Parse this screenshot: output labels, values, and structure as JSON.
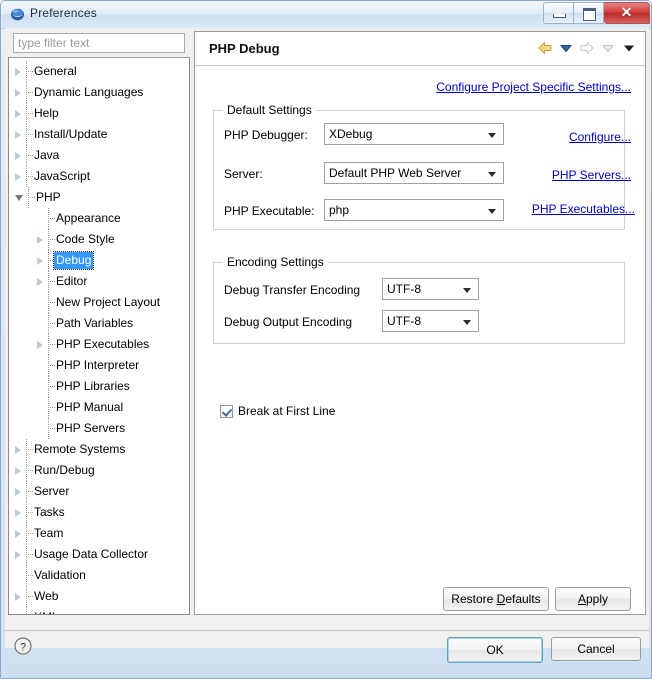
{
  "window": {
    "title": "Preferences",
    "icon": "eclipse-sphere-icon",
    "minimize_label": "",
    "maximize_label": "",
    "close_label": "✕"
  },
  "sidebar": {
    "filter": {
      "placeholder": "type filter text",
      "value": ""
    },
    "items": [
      {
        "label": "General",
        "depth": 0,
        "arrow": "collapsed"
      },
      {
        "label": "Dynamic Languages",
        "depth": 0,
        "arrow": "collapsed"
      },
      {
        "label": "Help",
        "depth": 0,
        "arrow": "collapsed"
      },
      {
        "label": "Install/Update",
        "depth": 0,
        "arrow": "collapsed"
      },
      {
        "label": "Java",
        "depth": 0,
        "arrow": "collapsed"
      },
      {
        "label": "JavaScript",
        "depth": 0,
        "arrow": "collapsed"
      },
      {
        "label": "PHP",
        "depth": 0,
        "arrow": "expanded"
      },
      {
        "label": "Appearance",
        "depth": 1,
        "arrow": "none"
      },
      {
        "label": "Code Style",
        "depth": 1,
        "arrow": "collapsed"
      },
      {
        "label": "Debug",
        "depth": 1,
        "arrow": "collapsed",
        "selected": true
      },
      {
        "label": "Editor",
        "depth": 1,
        "arrow": "collapsed"
      },
      {
        "label": "New Project Layout",
        "depth": 1,
        "arrow": "none"
      },
      {
        "label": "Path Variables",
        "depth": 1,
        "arrow": "none"
      },
      {
        "label": "PHP Executables",
        "depth": 1,
        "arrow": "collapsed"
      },
      {
        "label": "PHP Interpreter",
        "depth": 1,
        "arrow": "none"
      },
      {
        "label": "PHP Libraries",
        "depth": 1,
        "arrow": "none"
      },
      {
        "label": "PHP Manual",
        "depth": 1,
        "arrow": "none"
      },
      {
        "label": "PHP Servers",
        "depth": 1,
        "arrow": "none"
      },
      {
        "label": "Remote Systems",
        "depth": 0,
        "arrow": "collapsed"
      },
      {
        "label": "Run/Debug",
        "depth": 0,
        "arrow": "collapsed"
      },
      {
        "label": "Server",
        "depth": 0,
        "arrow": "collapsed"
      },
      {
        "label": "Tasks",
        "depth": 0,
        "arrow": "collapsed"
      },
      {
        "label": "Team",
        "depth": 0,
        "arrow": "collapsed"
      },
      {
        "label": "Usage Data Collector",
        "depth": 0,
        "arrow": "collapsed"
      },
      {
        "label": "Validation",
        "depth": 0,
        "arrow": "none"
      },
      {
        "label": "Web",
        "depth": 0,
        "arrow": "collapsed"
      },
      {
        "label": "XML",
        "depth": 0,
        "arrow": "collapsed"
      }
    ]
  },
  "page": {
    "title": "PHP Debug",
    "nav_icons": [
      {
        "name": "back-arrow-icon",
        "state": "enabled"
      },
      {
        "name": "back-history-dropdown-icon",
        "state": "enabled"
      },
      {
        "name": "forward-arrow-icon",
        "state": "disabled"
      },
      {
        "name": "forward-history-dropdown-icon",
        "state": "disabled"
      },
      {
        "name": "view-menu-dropdown-icon",
        "state": "enabled"
      }
    ],
    "project_specific_link": "Configure Project Specific Settings...",
    "default_settings": {
      "group_title": "Default Settings",
      "rows": [
        {
          "label": "PHP Debugger:",
          "value": "XDebug",
          "link": "Configure..."
        },
        {
          "label": "Server:",
          "value": "Default PHP Web Server",
          "link": "PHP Servers..."
        },
        {
          "label": "PHP Executable:",
          "value": "php",
          "link": "PHP Executables..."
        }
      ]
    },
    "encoding_settings": {
      "group_title": "Encoding Settings",
      "rows": [
        {
          "label": "Debug Transfer Encoding",
          "value": "UTF-8"
        },
        {
          "label": "Debug Output Encoding",
          "value": "UTF-8"
        }
      ]
    },
    "break_at_first_line": {
      "label": "Break at First Line",
      "checked": true
    }
  },
  "buttons": {
    "restore_defaults": "Restore Defaults",
    "restore_defaults_mnemonic": "D",
    "apply": "Apply",
    "apply_mnemonic": "A",
    "ok": "OK",
    "cancel": "Cancel",
    "help": "?"
  },
  "colors": {
    "selection_blue": "#3399ff",
    "link_blue": "#0000c0",
    "title_bar": "#dceaf7",
    "close_red": "#d2413e",
    "panel_bg": "#f1f0ef"
  }
}
